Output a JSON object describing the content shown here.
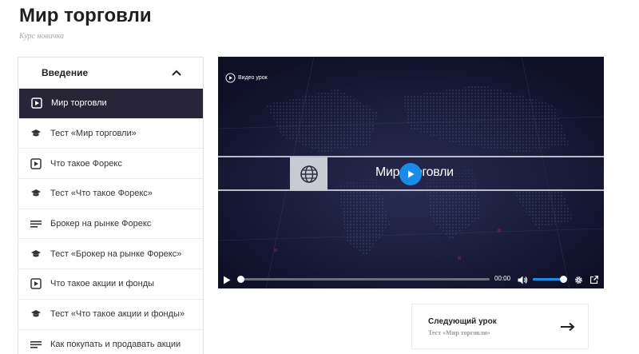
{
  "page": {
    "title": "Мир торговли",
    "subtitle": "Курс новичка"
  },
  "sidebar": {
    "section_title": "Введение",
    "items": [
      {
        "label": "Мир торговли",
        "icon": "video-icon",
        "active": true
      },
      {
        "label": "Тест «Мир торговли»",
        "icon": "graduation-cap-icon"
      },
      {
        "label": "Что такое Форекс",
        "icon": "video-icon"
      },
      {
        "label": "Тест «Что такое Форекс»",
        "icon": "graduation-cap-icon"
      },
      {
        "label": "Брокер на рынке Форекс",
        "icon": "text-lines-icon"
      },
      {
        "label": "Тест «Брокер на рынке Форекс»",
        "icon": "graduation-cap-icon"
      },
      {
        "label": "Что такое акции и фонды",
        "icon": "video-icon"
      },
      {
        "label": "Тест «Что такое акции и фонды»",
        "icon": "graduation-cap-icon"
      },
      {
        "label": "Как покупать и продавать акции",
        "icon": "text-lines-icon"
      }
    ]
  },
  "player": {
    "badge": "Видео урок",
    "video_title": "Мир торговли",
    "time": "00:00",
    "progress": 0,
    "volume": 1.0,
    "accent": "#1a8ce8",
    "background": "#14162e"
  },
  "next": {
    "label": "Следующий урок",
    "title": "Тест «Мир торговли»"
  },
  "colors": {
    "active_item_bg": "#272537"
  }
}
